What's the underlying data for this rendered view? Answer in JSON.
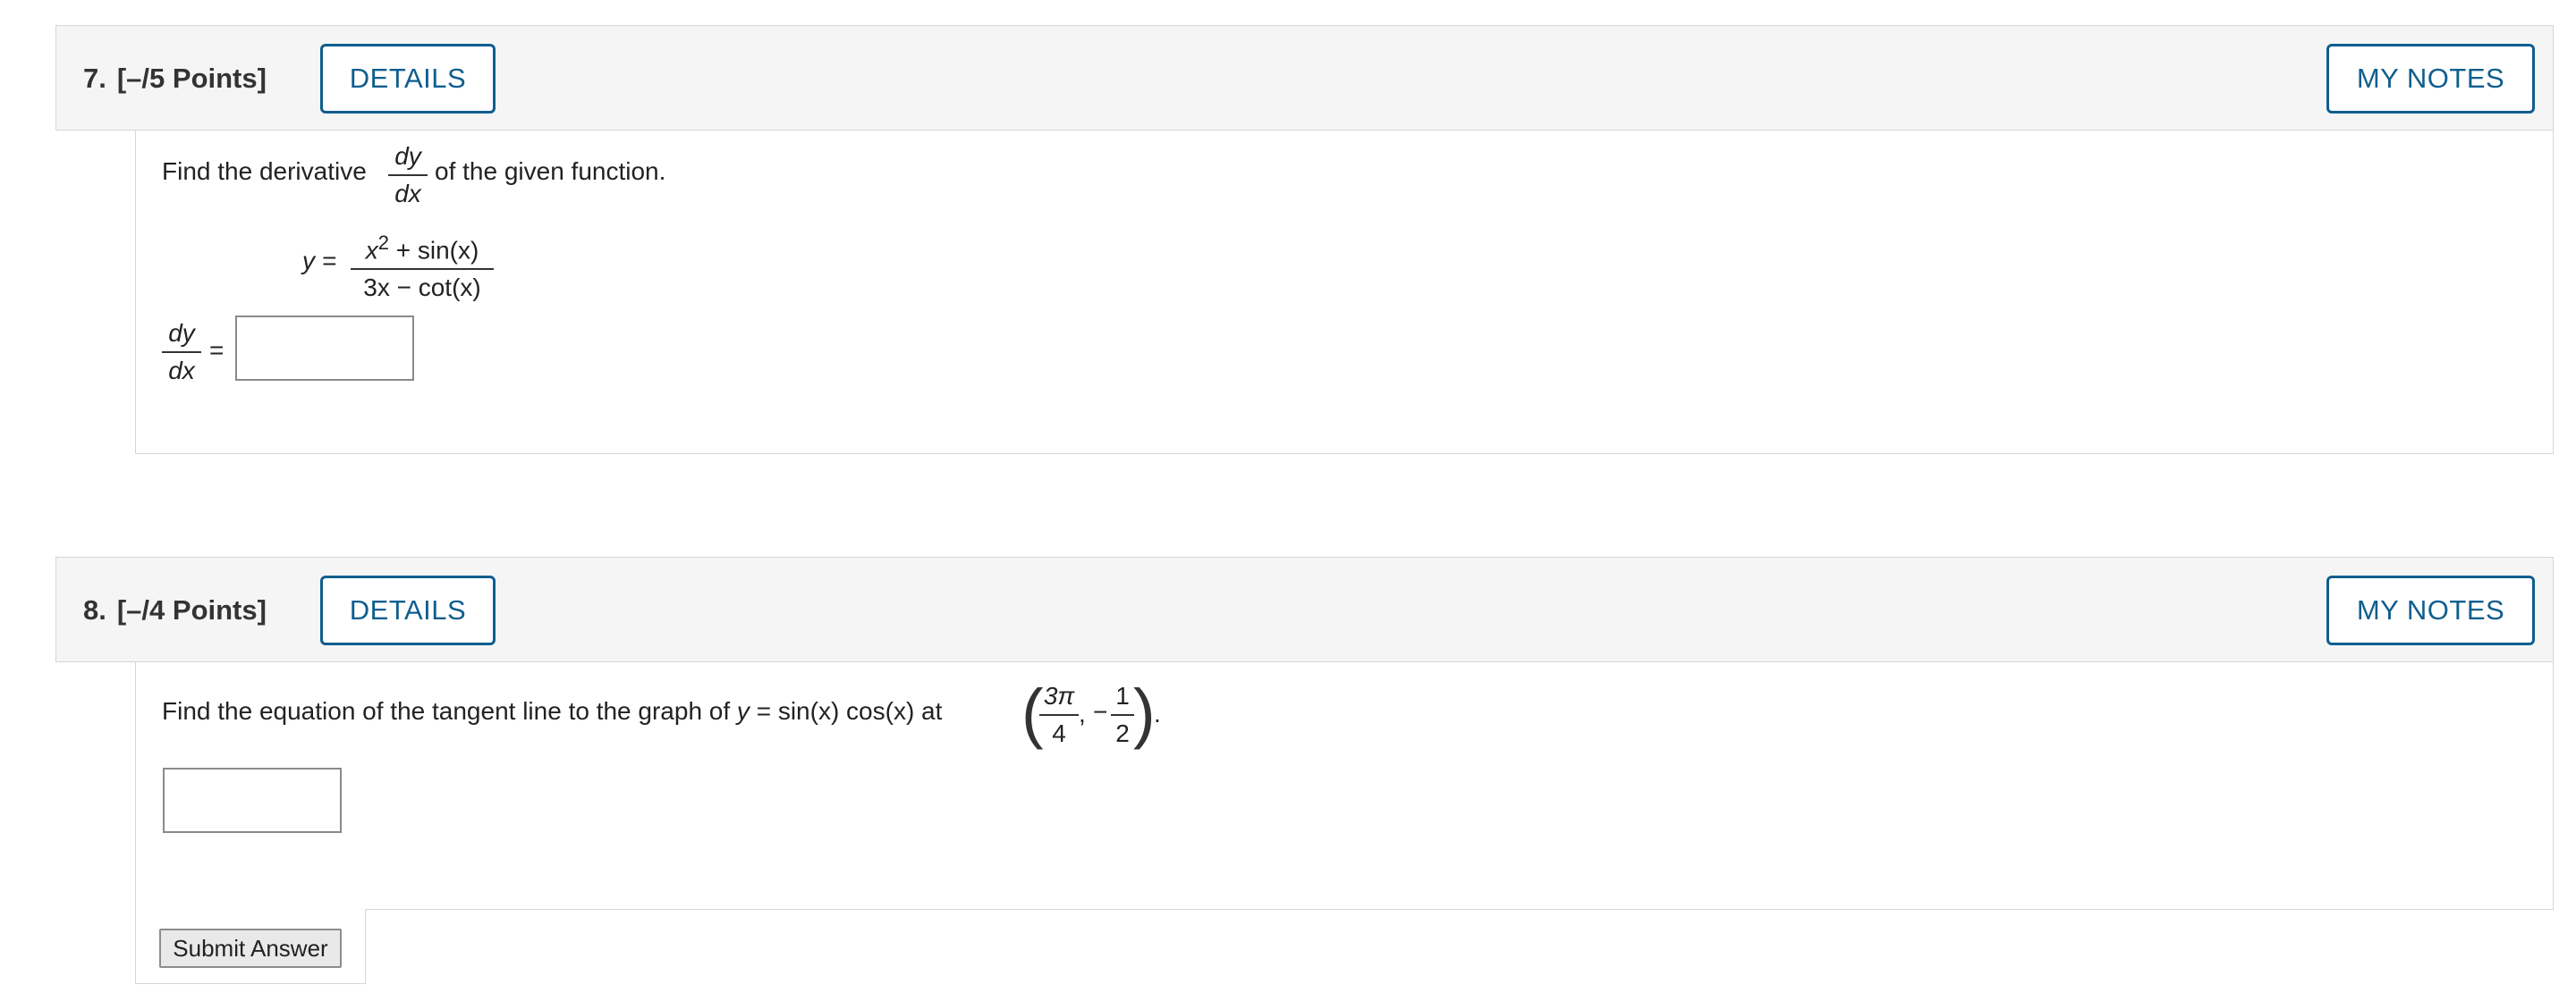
{
  "questions": [
    {
      "number": "7.",
      "points": "[–/5 Points]",
      "details_label": "DETAILS",
      "notes_label": "MY NOTES",
      "prompt_before": "Find the derivative",
      "prompt_after": "of the given function.",
      "deriv_num": "dy",
      "deriv_den": "dx",
      "func_lhs": "y =",
      "func_num_x": "x",
      "func_num_exp": "2",
      "func_num_rest": "+ sin(x)",
      "func_den": "3x − cot(x)",
      "answer_lhs_num": "dy",
      "answer_lhs_den": "dx",
      "answer_eq": "=",
      "answer_value": ""
    },
    {
      "number": "8.",
      "points": "[–/4 Points]",
      "details_label": "DETAILS",
      "notes_label": "MY NOTES",
      "prompt_pre": "Find the equation of the tangent line to the graph of",
      "prompt_y": "y",
      "prompt_mid": "= sin(x) cos(x) at",
      "point_x_num": "3π",
      "point_x_den": "4",
      "point_comma": ",",
      "point_neg": "−",
      "point_y_num": "1",
      "point_y_den": "2",
      "point_end": ".",
      "answer_value": ""
    }
  ],
  "submit_label": "Submit Answer"
}
